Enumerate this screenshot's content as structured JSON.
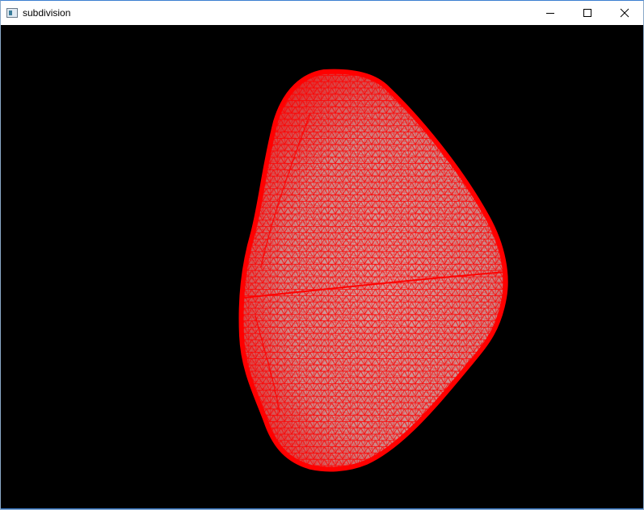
{
  "window": {
    "title": "subdivision",
    "icon": "app-window-icon",
    "controls": [
      {
        "name": "minimize-button",
        "icon": "minimize-icon"
      },
      {
        "name": "maximize-button",
        "icon": "maximize-icon"
      },
      {
        "name": "close-button",
        "icon": "close-icon"
      }
    ]
  },
  "viewport": {
    "background": "#000000",
    "mesh_color": "#ff0000",
    "mesh_fill": "#c89898",
    "render_mode": "wireframe-triangle-mesh"
  }
}
